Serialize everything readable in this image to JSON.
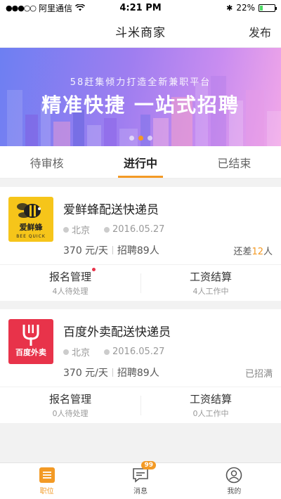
{
  "status_bar": {
    "carrier": "阿里通信",
    "time": "4:21 PM",
    "battery": "22%",
    "battery_level": 0.22
  },
  "nav": {
    "title": "斗米商家",
    "action": "发布"
  },
  "banner": {
    "subtitle": "58赶集倾力打造全新兼职平台",
    "title": "精准快捷 一站式招聘",
    "slide_count": 3,
    "active_slide": 1
  },
  "tabs": [
    {
      "label": "待审核",
      "active": false
    },
    {
      "label": "进行中",
      "active": true
    },
    {
      "label": "已结束",
      "active": false
    }
  ],
  "jobs": [
    {
      "title": "爱鲜蜂配送快递员",
      "logo_text": "爱鲜蜂",
      "logo_sub": "BEE QUICK",
      "city": "北京",
      "date": "2016.05.27",
      "salary": "370 元/天",
      "hiring": "招聘89人",
      "status_prefix": "还差",
      "status_number": "12",
      "status_suffix": "人",
      "actions": [
        {
          "label": "报名管理",
          "sub": "4人待处理",
          "dot": true
        },
        {
          "label": "工资结算",
          "sub": "4人工作中",
          "dot": false
        }
      ]
    },
    {
      "title": "百度外卖配送快递员",
      "logo_text": "百度外卖",
      "city": "北京",
      "date": "2016.05.27",
      "salary": "370 元/天",
      "hiring": "招聘89人",
      "status": "已招满",
      "actions": [
        {
          "label": "报名管理",
          "sub": "0人待处理",
          "dot": false
        },
        {
          "label": "工资结算",
          "sub": "0人工作中",
          "dot": false
        }
      ]
    }
  ],
  "bottom_bar": [
    {
      "label": "职位",
      "icon": "list-icon",
      "active": true
    },
    {
      "label": "消息",
      "icon": "message-icon",
      "badge": "99",
      "active": false
    },
    {
      "label": "我的",
      "icon": "user-icon",
      "active": false
    }
  ],
  "colors": {
    "accent": "#f39a25",
    "red": "#e8334a",
    "bee_yellow": "#f6c51a"
  }
}
